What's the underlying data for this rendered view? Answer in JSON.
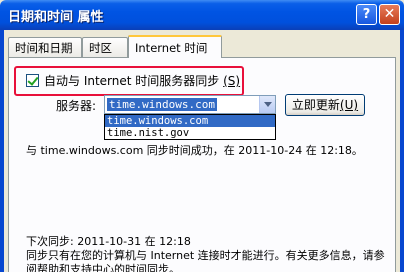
{
  "window": {
    "title": "日期和时间 属性",
    "help_glyph": "?",
    "close_glyph": "✕"
  },
  "tabs": [
    {
      "label": "时间和日期"
    },
    {
      "label": "时区"
    },
    {
      "label": "Internet 时间"
    }
  ],
  "sync": {
    "checkbox_label": "自动与 Internet 时间服务器同步",
    "checkbox_hotkey": "(S)",
    "checked": true,
    "server_label": "服务器:",
    "server_value": "time.windows.com",
    "update_button": "立即更新",
    "update_hotkey": "(U)",
    "dropdown_options": [
      "time.windows.com",
      "time.nist.gov"
    ],
    "status": "与 time.windows.com 同步时间成功，在 2011-10-24 在 12:18。",
    "next_sync": "下次同步: 2011-10-31 在 12:18",
    "info": "同步只有在您的计算机与 Internet 连接时才能进行。有关更多信息，请参阅帮助和支持中心的时间同步。"
  },
  "colors": {
    "title_bar": "#0054e3",
    "highlight_border": "#e8103a",
    "selection": "#316ac5",
    "check_mark": "#21a121"
  }
}
